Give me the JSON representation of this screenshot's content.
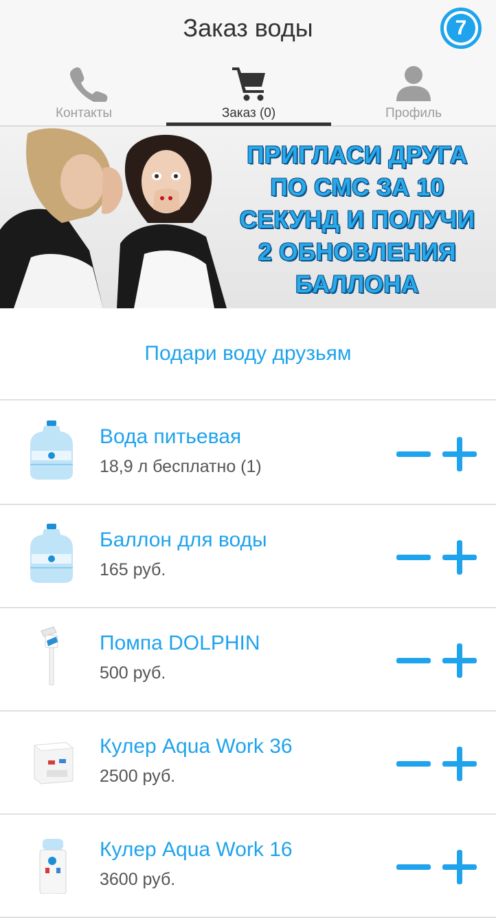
{
  "header": {
    "title": "Заказ воды",
    "badge_count": "7"
  },
  "tabs": [
    {
      "label": "Контакты",
      "icon": "phone-icon"
    },
    {
      "label": "Заказ (0)",
      "icon": "cart-icon",
      "active": true
    },
    {
      "label": "Профиль",
      "icon": "user-icon"
    }
  ],
  "banner": {
    "lines": [
      "ПРИГЛАСИ ДРУГА",
      "ПО СМС ЗА 10",
      "СЕКУНД И ПОЛУЧИ",
      "2 ОБНОВЛЕНИЯ",
      "БАЛЛОНА"
    ]
  },
  "gift": {
    "label": "Подари воду друзьям"
  },
  "products": [
    {
      "name": "Вода питьевая",
      "price": "18,9 л бесплатно (1)",
      "image": "water-bottle-image"
    },
    {
      "name": "Баллон для воды",
      "price": "165 руб.",
      "image": "water-bottle-image"
    },
    {
      "name": "Помпа DOLPHIN",
      "price": "500 руб.",
      "image": "pump-image"
    },
    {
      "name": "Кулер Aqua Work 36",
      "price": "2500 руб.",
      "image": "desktop-cooler-image"
    },
    {
      "name": "Кулер Aqua Work 16",
      "price": "3600 руб.",
      "image": "floor-cooler-image"
    }
  ],
  "colors": {
    "accent": "#1fa3ec",
    "text_dark": "#333333",
    "text_muted": "#9b9b9b",
    "header_bg": "#f7f7f7"
  }
}
